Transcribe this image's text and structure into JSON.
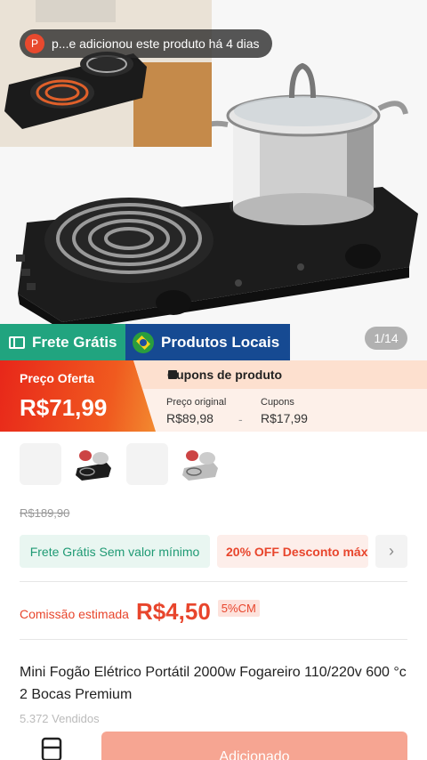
{
  "notice": {
    "avatar_letter": "P",
    "text": "p...e adicionou este produto há 4 dias"
  },
  "badges": {
    "frete": "Frete Grátis",
    "locais": "Produtos Locais"
  },
  "gallery": {
    "pager": "1/14"
  },
  "price": {
    "offer_label": "Preço Oferta",
    "offer_value": "R$71,99",
    "coupons_header": "Cupons de produto",
    "original_label": "Preço original",
    "original_value": "R$89,98",
    "minus": "-",
    "coupons_label": "Cupons",
    "coupons_value": "R$17,99"
  },
  "old_price": "R$189,90",
  "promos": {
    "free_shipping": "Frete Grátis Sem valor mínimo",
    "discount": "20% OFF Desconto máx"
  },
  "commission": {
    "label": "Comissão estimada",
    "value": "R$4,50",
    "percent": "5%CM"
  },
  "product": {
    "title": "Mini Fogão Elétrico Portátil 2000w Fogareiro 110/220v 600 °c 2 Bocas Premium",
    "sold": "5.372 Vendidos"
  },
  "bottom": {
    "added_label": "Adicionado"
  },
  "colors": {
    "accent": "#e8452c",
    "frete_green": "#21a47f",
    "locais_blue": "#164a92"
  }
}
